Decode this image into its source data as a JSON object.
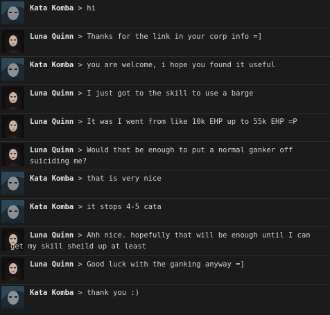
{
  "chat": {
    "separator": " > ",
    "messages": [
      {
        "speaker": "Kata Komba",
        "text": "hi",
        "avatar": "kata-avatar"
      },
      {
        "speaker": "Luna Quinn",
        "text": "Thanks for the link in your corp info =]",
        "avatar": "luna-avatar"
      },
      {
        "speaker": "Kata Komba",
        "text": "you are welcome, i hope you found it useful",
        "avatar": "kata-avatar"
      },
      {
        "speaker": "Luna Quinn",
        "text": "I just got to the skill to use a barge",
        "avatar": "luna-avatar"
      },
      {
        "speaker": "Luna Quinn",
        "text": "It was I went from like 10k EHP up to 55k EHP =P",
        "avatar": "luna-avatar"
      },
      {
        "speaker": "Luna Quinn",
        "text": "Would that be enough to put a normal ganker off suiciding me?",
        "avatar": "luna-avatar"
      },
      {
        "speaker": "Kata Komba",
        "text": "that is very nice",
        "avatar": "kata-avatar"
      },
      {
        "speaker": "Kata Komba",
        "text": "it stops 4-5 cata",
        "avatar": "kata-avatar"
      },
      {
        "speaker": "Luna Quinn",
        "text": "Ahh nice. hopefully that will be enough until I can get my skill sheild up at least",
        "avatar": "luna-avatar"
      },
      {
        "speaker": "Luna Quinn",
        "text": "Good luck with the ganking anyway =]",
        "avatar": "luna-avatar"
      },
      {
        "speaker": "Kata Komba",
        "text": "thank you :)",
        "avatar": "kata-avatar"
      }
    ]
  }
}
